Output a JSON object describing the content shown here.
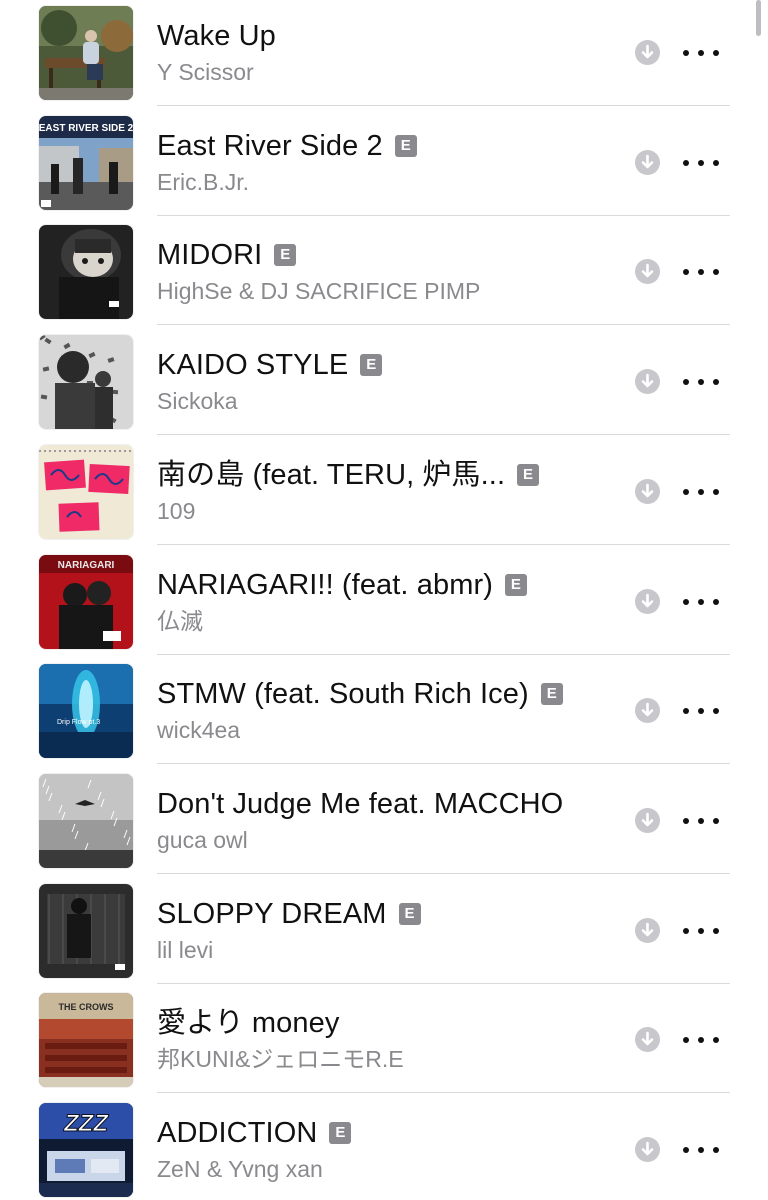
{
  "tracks": [
    {
      "title": "Wake Up",
      "artist": "Y Scissor",
      "explicit": false,
      "art": "bench"
    },
    {
      "title": "East River Side 2",
      "artist": "Eric.B.Jr.",
      "explicit": true,
      "art": "street"
    },
    {
      "title": "MIDORI",
      "artist": "HighSe & DJ SACRIFICE PIMP",
      "explicit": true,
      "art": "anime"
    },
    {
      "title": "KAIDO STYLE",
      "artist": "Sickoka",
      "explicit": true,
      "art": "mono"
    },
    {
      "title": "南の島 (feat. TERU, 炉馬...",
      "artist": "109",
      "explicit": true,
      "art": "cards"
    },
    {
      "title": "NARIAGARI!! (feat. abmr)",
      "artist": "仏滅",
      "explicit": true,
      "art": "red"
    },
    {
      "title": "STMW (feat. South Rich Ice)",
      "artist": "wick4ea",
      "explicit": true,
      "art": "blue"
    },
    {
      "title": "Don't Judge Me feat. MACCHO",
      "artist": "guca owl",
      "explicit": false,
      "art": "rain"
    },
    {
      "title": "SLOPPY DREAM",
      "artist": "lil levi",
      "explicit": true,
      "art": "dark"
    },
    {
      "title": "愛より money",
      "artist": "邦KUNI&ジェロニモR.E",
      "explicit": false,
      "art": "crows"
    },
    {
      "title": "ADDICTION",
      "artist": "ZeN & Yvng xan",
      "explicit": true,
      "art": "zzz"
    }
  ],
  "explicit_label": "E",
  "artwork_text": {
    "East River Side 2": "EAST RIVER SIDE 2",
    "NARIAGARI!! (feat. abmr)": "NARIAGARI",
    "STMW (feat. South Rich Ice)": "Drip Flow pt.3",
    "愛より money": "THE CROWS",
    "ADDICTION": "ZZZ"
  },
  "colors": {
    "background": "#ffffff",
    "title": "#111111",
    "subtitle": "#8a8a8e",
    "explicit_badge": "#8a8a8e",
    "download_circle": "#c7c7cc",
    "separator": "#d9d9de"
  },
  "icons": {
    "download": "arrow-down-circle-icon",
    "more": "ellipsis-icon",
    "explicit": "explicit-badge"
  }
}
